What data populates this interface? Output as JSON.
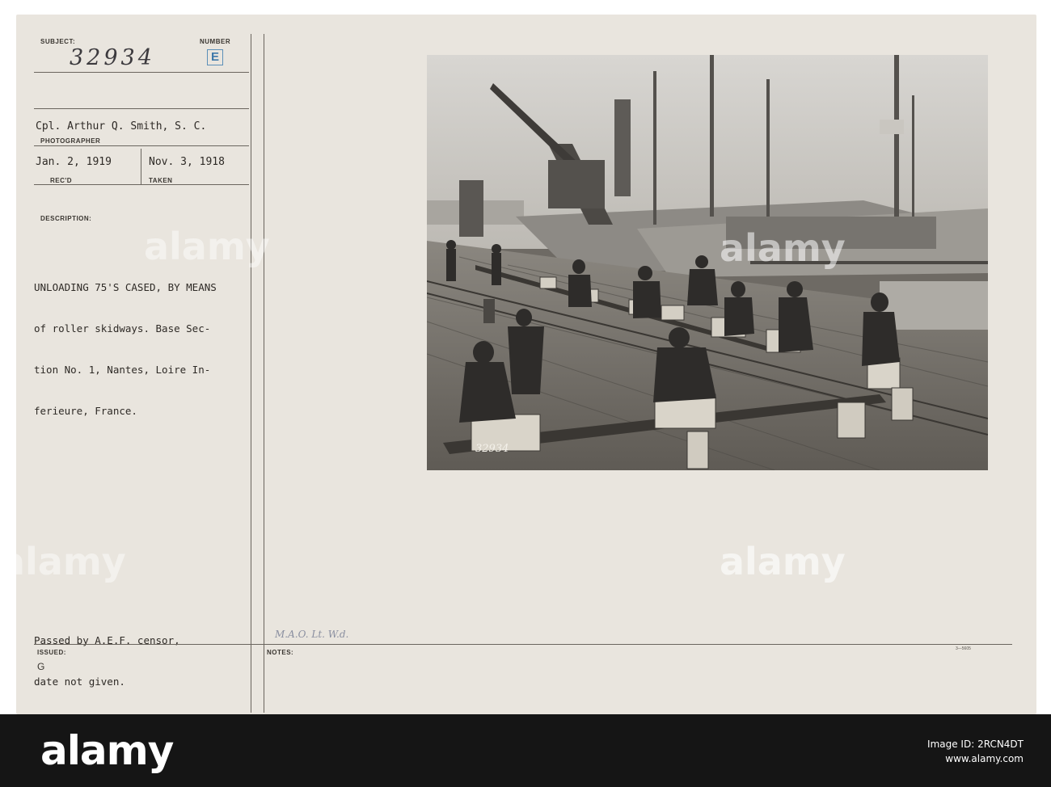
{
  "card": {
    "subject_label": "SUBJECT:",
    "subject_value": "32934",
    "number_label": "NUMBER",
    "number_value": "E",
    "photographer_value": "Cpl. Arthur Q. Smith, S. C.",
    "photographer_label": "PHOTOGRAPHER",
    "recd_value": "Jan. 2, 1919",
    "recd_label": "REC'D",
    "taken_value": "Nov. 3, 1918",
    "taken_label": "TAKEN",
    "description_label": "DESCRIPTION:",
    "description_lines": [
      "UNLOADING 75'S CASED, BY MEANS",
      "of roller skidways. Base Sec-",
      "tion No. 1, Nantes, Loire In-",
      "ferieure, France."
    ],
    "censor_lines": [
      "Passed by A.E.F. censor,",
      "date not given."
    ],
    "issued_label": "ISSUED:",
    "issued_value": "G",
    "notes_label": "NOTES:",
    "notes_handwritten": "M.A.O. Lt. W.d.",
    "form_code": "3—5605",
    "photo_negative_number": "32934"
  },
  "watermark": {
    "brand": "alamy",
    "image_id_line": "Image ID: 2RCN4DT",
    "site": "www.alamy.com",
    "ghost_text": "alamy"
  },
  "colors": {
    "card": "#e9e5de",
    "stamp_blue": "#3e79aa",
    "watermark_bar": "#151515"
  }
}
